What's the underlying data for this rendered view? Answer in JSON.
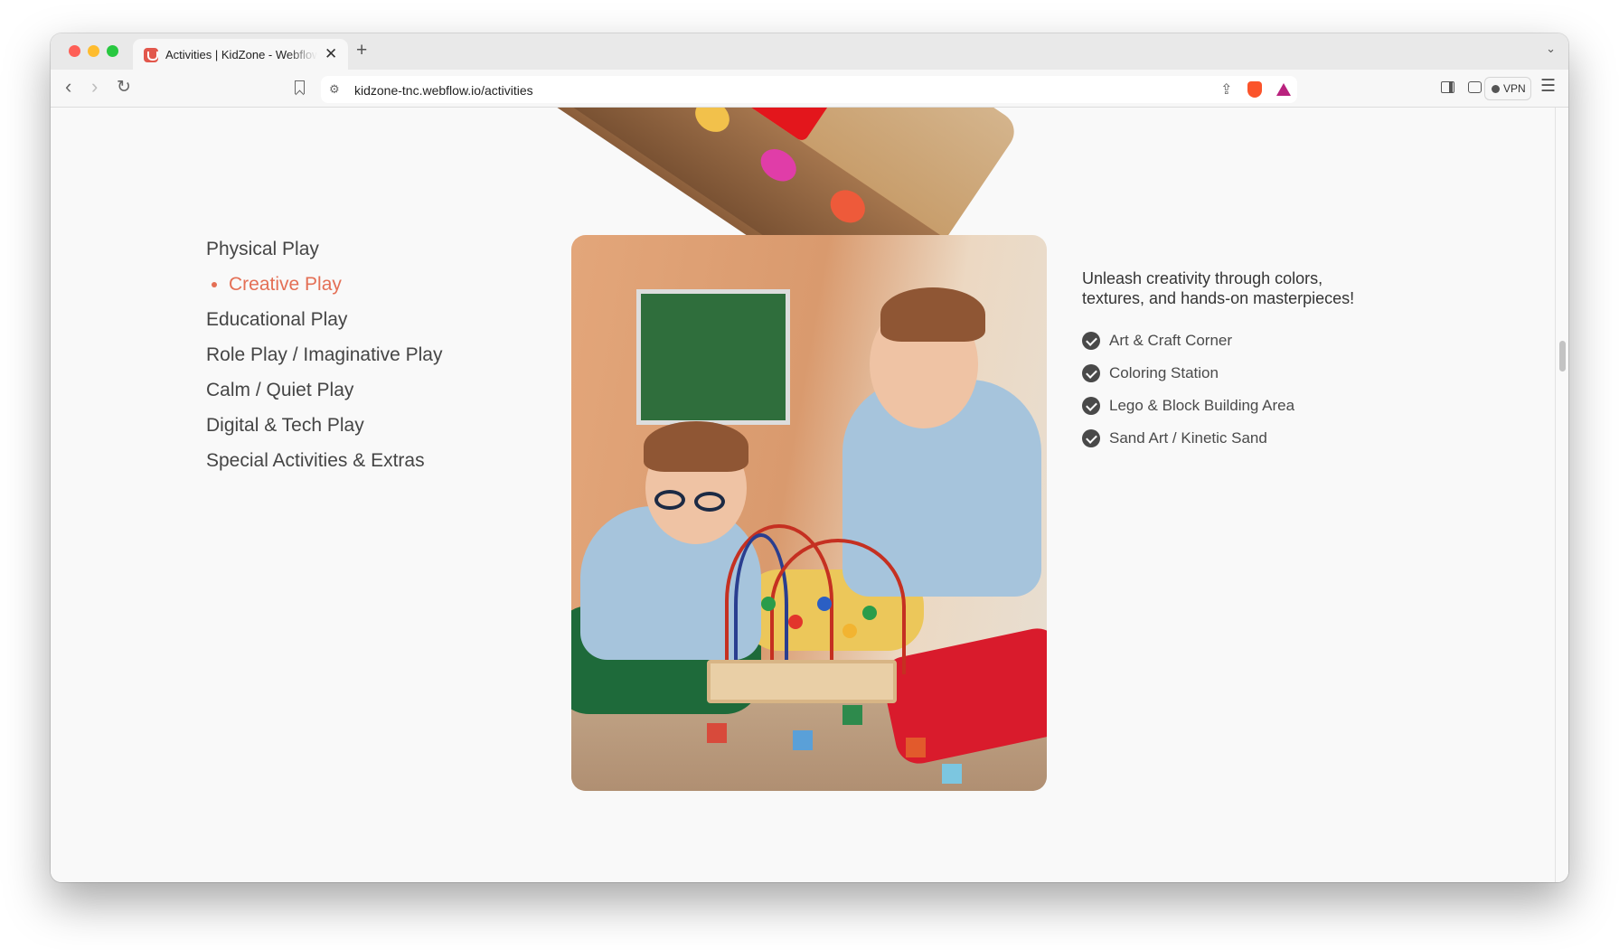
{
  "browser": {
    "tab_title": "Activities | KidZone - Webflow",
    "tab_close_glyph": "✕",
    "new_tab_glyph": "+",
    "url": "kidzone-tnc.webflow.io/activities",
    "vpn_label": "VPN",
    "icons": {
      "favicon": "kidzone-favicon-icon",
      "back": "chevron-left-icon",
      "forward": "chevron-right-icon",
      "reload": "reload-icon",
      "bookmark": "bookmark-icon",
      "site_settings": "site-settings-icon",
      "share": "share-icon",
      "shields": "brave-shields-icon",
      "rewards": "brave-rewards-icon",
      "sidebar": "sidebar-toggle-icon",
      "wallet": "wallet-icon",
      "menu": "hamburger-menu-icon",
      "tab_list": "chevron-down-icon"
    }
  },
  "activities": {
    "categories": [
      {
        "label": "Physical Play",
        "active": false
      },
      {
        "label": "Creative Play",
        "active": true
      },
      {
        "label": "Educational Play",
        "active": false
      },
      {
        "label": "Role Play / Imaginative Play",
        "active": false
      },
      {
        "label": "Calm / Quiet Play",
        "active": false
      },
      {
        "label": "Digital & Tech Play",
        "active": false
      },
      {
        "label": "Special Activities & Extras",
        "active": false
      }
    ],
    "description": "Unleash creativity through colors, textures, and hands-on masterpieces!",
    "features": [
      "Art & Craft Corner",
      "Coloring Station",
      "Lego & Block Building Area",
      "Sand Art / Kinetic Sand"
    ]
  },
  "colors": {
    "accent": "#e46f55",
    "text_primary": "#454545",
    "check_icon": "#494949",
    "page_background": "#f9f9f9"
  }
}
